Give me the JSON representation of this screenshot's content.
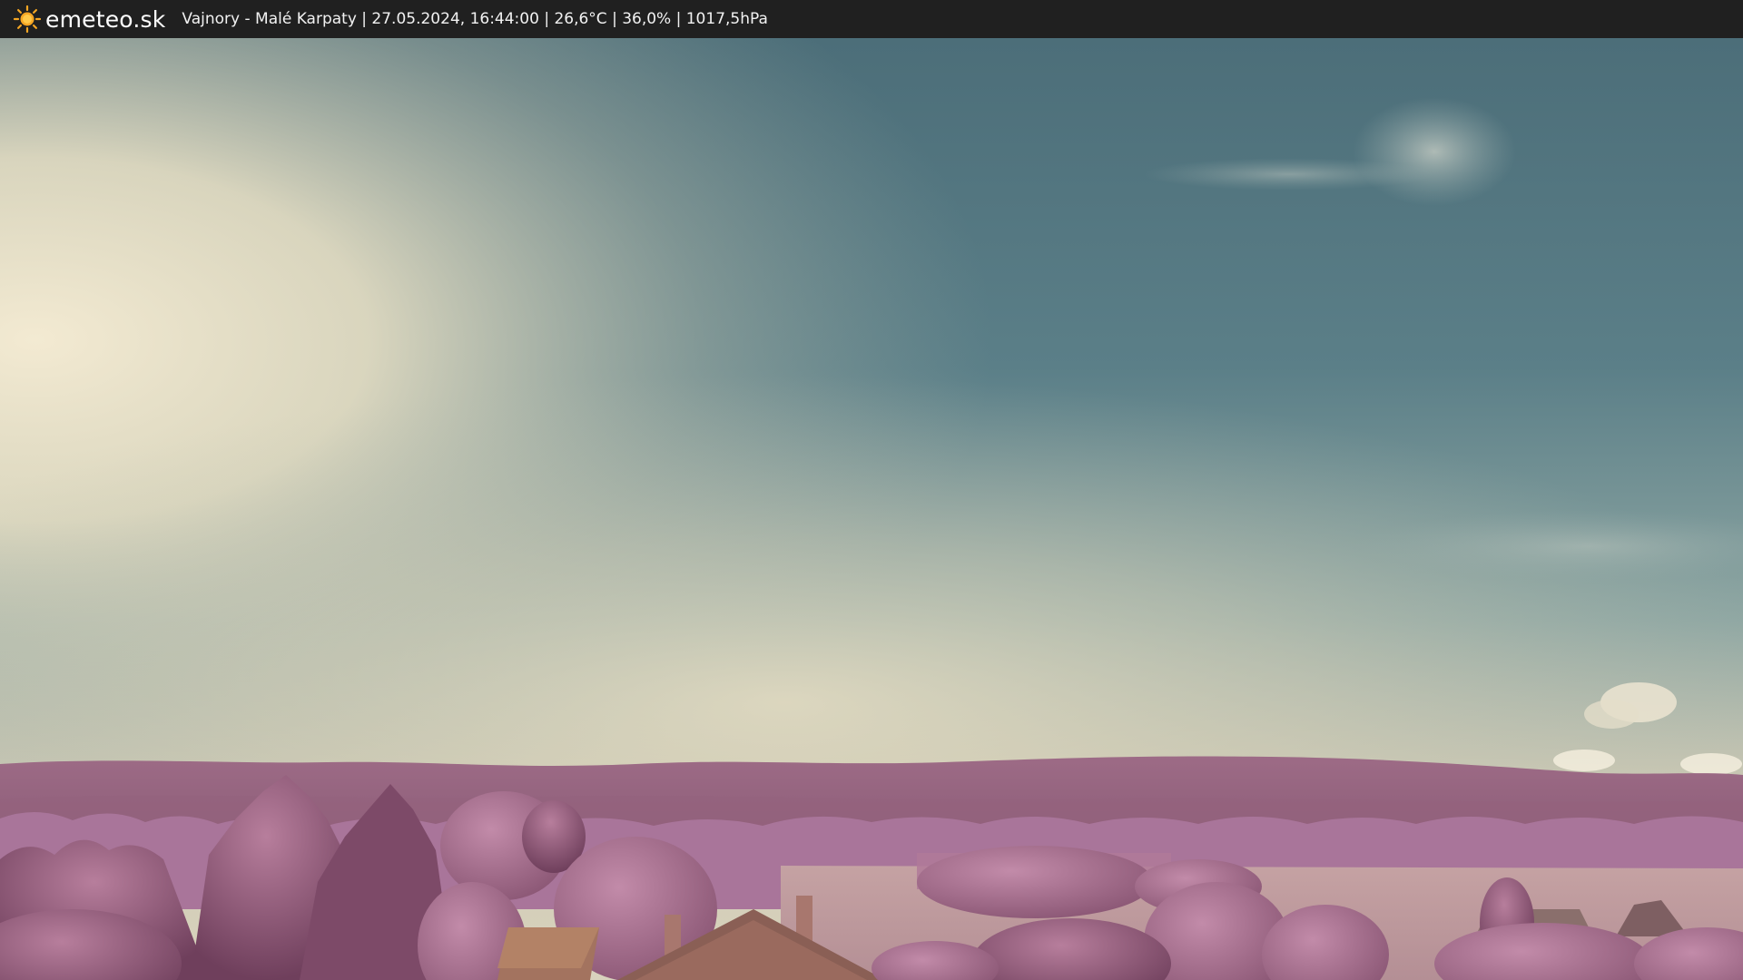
{
  "header": {
    "brand": "emeteo.sk",
    "caption": "Vajnory - Malé Karpaty | 27.05.2024, 16:44:00 | 26,6°C | 36,0% | 1017,5hPa",
    "logo_icon": "sun-icon",
    "logo_color": "#f5a623"
  },
  "scene": {
    "description_colors": {
      "sky_top": "#4f6f79",
      "sky_haze": "#ece3c9",
      "vegetation": "#b07a99",
      "field": "#c9a7a8"
    }
  }
}
